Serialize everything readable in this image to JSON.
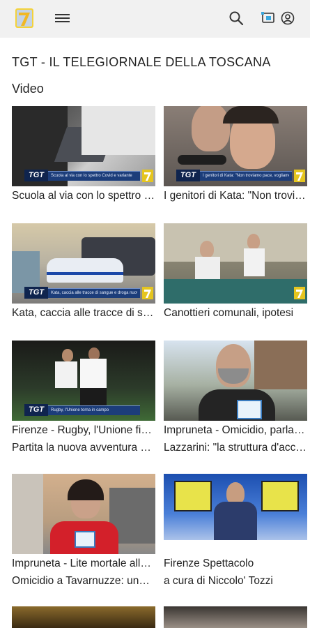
{
  "header": {
    "logo_icon": "tv7-logo-icon",
    "menu_icon": "hamburger-menu-icon",
    "search_icon": "search-icon",
    "cast_icon": "cast-icon",
    "account_icon": "account-icon"
  },
  "page": {
    "title": "TGT - IL TELEGIORNALE DELLA TOSCANA",
    "subtitle": "Video"
  },
  "videos": [
    {
      "title": "Scuola al via con lo spettro Covid...",
      "subtitle": "",
      "ticker": "Scuola al via con lo spettro Covid e variante"
    },
    {
      "title": "I genitori di Kata: \"Non troviamo pace\"",
      "subtitle": "",
      "ticker": "I genitori di Kata: \"Non troviamo pace, vogliamo risposte\""
    },
    {
      "title": "Kata, caccia alle tracce di sangue",
      "subtitle": "",
      "ticker": "Kata, caccia alle tracce di sangue e droga nuovi indagati"
    },
    {
      "title": "Canottieri comunali, ipotesi",
      "subtitle": "",
      "ticker": ""
    },
    {
      "title": "Firenze - Rugby, l'Unione fiorentina",
      "subtitle": "Partita la nuova avventura stagionale",
      "ticker": "Rugby, l'Unione torna in campo"
    },
    {
      "title": "Impruneta - Omicidio, parla il sindaco",
      "subtitle": "Lazzarini: \"la struttura d'accoglienza\"",
      "ticker": ""
    },
    {
      "title": "Impruneta - Lite mortale alla struttura",
      "subtitle": "Omicidio a Tavarnuzze: una lite",
      "ticker": ""
    },
    {
      "title": "Firenze Spettacolo",
      "subtitle": "a cura di Niccolo' Tozzi",
      "ticker": ""
    }
  ],
  "colors": {
    "topbar": "#f1f1f1",
    "band": "#1c3d7a",
    "accent_yellow": "#e5c51f"
  }
}
